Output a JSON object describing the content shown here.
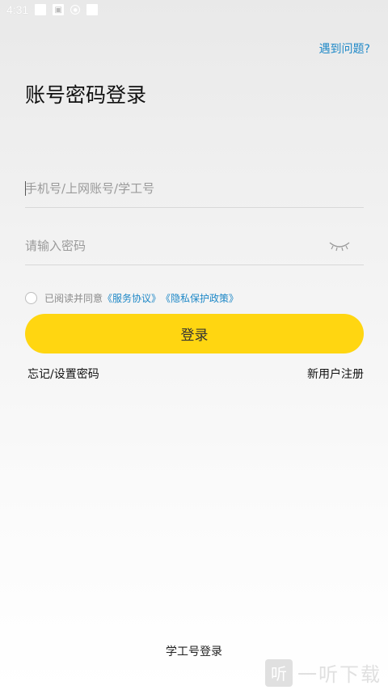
{
  "status_bar": {
    "time": "4:31"
  },
  "header": {
    "help_link": "遇到问题?"
  },
  "page": {
    "title": "账号密码登录"
  },
  "form": {
    "account_placeholder": "手机号/上网账号/学工号",
    "password_placeholder": "请输入密码",
    "agreement_prefix": "已阅读并同意",
    "terms_link": "《服务协议》",
    "privacy_link": "《隐私保护政策》",
    "login_label": "登录",
    "forgot_link": "忘记/设置密码",
    "register_link": "新用户注册"
  },
  "footer": {
    "student_login": "学工号登录"
  },
  "watermark": {
    "glyph": "听",
    "text": "一听下载"
  },
  "icons": {
    "password_toggle": "eye-closed-icon"
  },
  "colors": {
    "accent": "#ffd611",
    "link": "#1e88c7"
  }
}
